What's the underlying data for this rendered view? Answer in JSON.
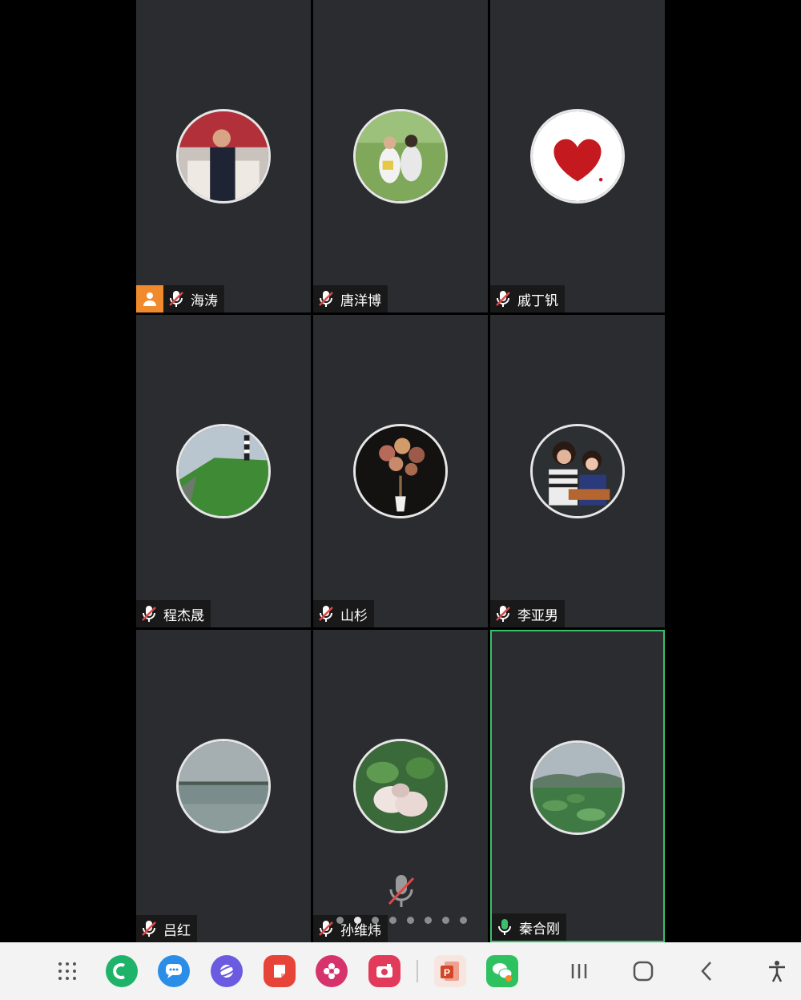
{
  "participants": [
    {
      "name": "海涛",
      "host": true,
      "mic": "muted"
    },
    {
      "name": "唐洋博",
      "host": false,
      "mic": "muted"
    },
    {
      "name": "戚丁钒",
      "host": false,
      "mic": "muted"
    },
    {
      "name": "程杰晟",
      "host": false,
      "mic": "muted"
    },
    {
      "name": "山杉",
      "host": false,
      "mic": "muted"
    },
    {
      "name": "李亚男",
      "host": false,
      "mic": "muted"
    },
    {
      "name": "吕红",
      "host": false,
      "mic": "muted"
    },
    {
      "name": "孙维炜",
      "host": false,
      "mic": "muted"
    },
    {
      "name": "秦合刚",
      "host": false,
      "mic": "active",
      "speaking": true
    }
  ],
  "pager": {
    "total": 8,
    "current": 2
  },
  "taskbar": {
    "apps": [
      "apps-grid-icon",
      "phone-app-icon",
      "messages-app-icon",
      "browser-app-icon",
      "notes-app-icon",
      "gallery-app-icon",
      "camera-app-icon",
      "powerpoint-app-icon",
      "wechat-app-icon"
    ],
    "nav": [
      "recents-icon",
      "home-icon",
      "back-icon",
      "accessibility-icon"
    ]
  },
  "colors": {
    "tile": "#2a2c2f",
    "host_badge": "#f08a2c",
    "active_border": "#3bbf6a",
    "muted_mic": "#e04848"
  }
}
